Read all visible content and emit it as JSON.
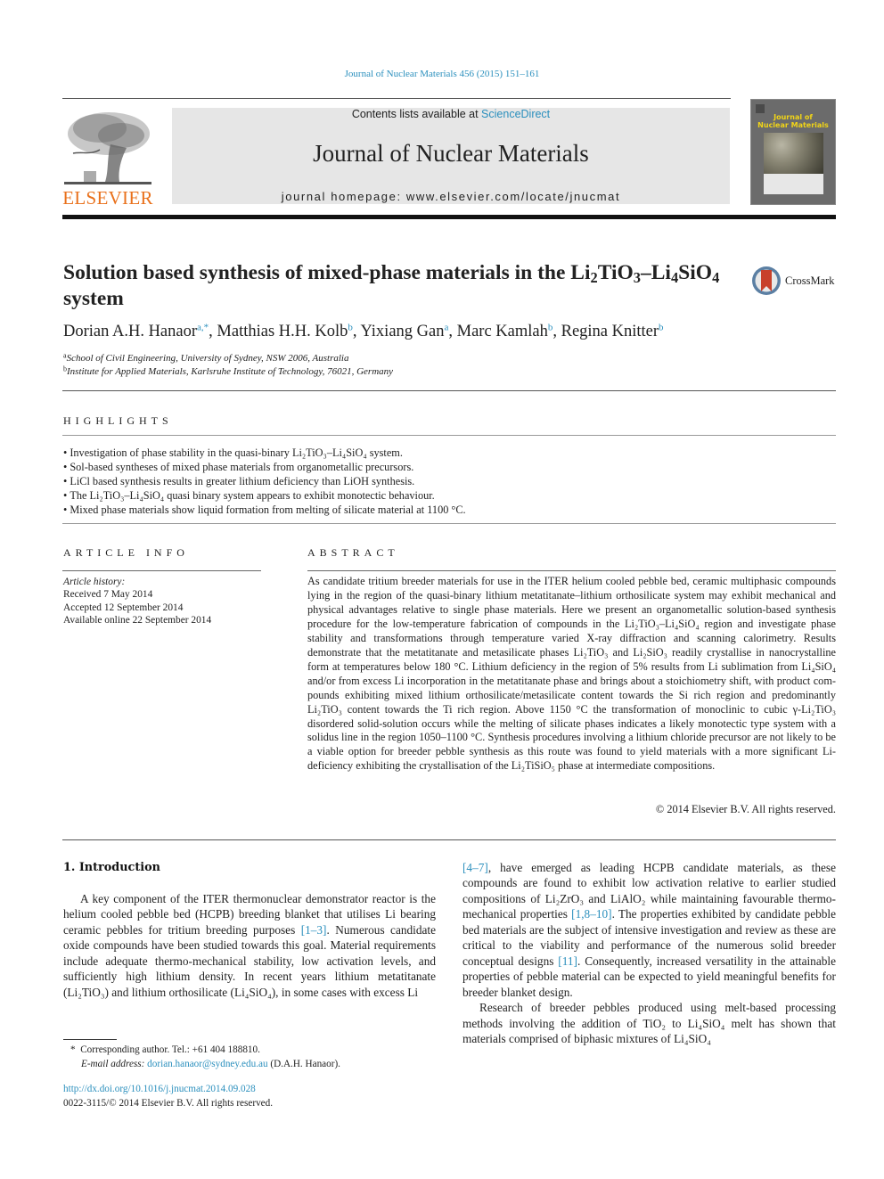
{
  "running_head": "Journal of Nuclear Materials 456 (2015) 151–161",
  "masthead": {
    "contents_prefix": "Contents lists available at ",
    "contents_link": "ScienceDirect",
    "journal_title": "Journal of Nuclear Materials",
    "homepage": "journal homepage: www.elsevier.com/locate/jnucmat"
  },
  "publisher_logo": {
    "wordmark": "ELSEVIER",
    "color": "#e9711c"
  },
  "cover": {
    "title_line1": "Journal of",
    "title_line2": "Nuclear Materials",
    "title_color": "#f1d417"
  },
  "crossmark": {
    "label": "CrossMark"
  },
  "article": {
    "title_pre": "Solution based synthesis of mixed-phase materials in the Li",
    "title_sub1": "2",
    "title_mid1": "TiO",
    "title_sub2": "3",
    "title_mid2": "–Li",
    "title_sub3": "4",
    "title_mid3": "SiO",
    "title_sub4": "4",
    "title_post": " system",
    "authors": [
      {
        "name": "Dorian A.H. Hanaor",
        "sup": "a,*"
      },
      {
        "name": "Matthias H.H. Kolb",
        "sup": "b"
      },
      {
        "name": "Yixiang Gan",
        "sup": "a"
      },
      {
        "name": "Marc Kamlah",
        "sup": "b"
      },
      {
        "name": "Regina Knitter",
        "sup": "b"
      }
    ],
    "affiliations": [
      {
        "key": "a",
        "text": "School of Civil Engineering, University of Sydney, NSW 2006, Australia"
      },
      {
        "key": "b",
        "text": "Institute for Applied Materials, Karlsruhe Institute of Technology, 76021, Germany"
      }
    ]
  },
  "highlights": {
    "heading": "HIGHLIGHTS",
    "items": [
      "Investigation of phase stability in the quasi-binary Li₂TiO₃–Li₄SiO₄ system.",
      "Sol-based syntheses of mixed phase materials from organometallic precursors.",
      "LiCl based synthesis results in greater lithium deficiency than LiOH synthesis.",
      "The Li₂TiO₃–Li₄SiO₄ quasi binary system appears to exhibit monotectic behaviour.",
      "Mixed phase materials show liquid formation from melting of silicate material at 1100 °C."
    ]
  },
  "article_info": {
    "heading": "ARTICLE INFO",
    "history_label": "Article history:",
    "received": "Received 7 May 2014",
    "accepted": "Accepted 12 September 2014",
    "online": "Available online 22 September 2014"
  },
  "abstract": {
    "heading": "ABSTRACT",
    "text": "As candidate tritium breeder materials for use in the ITER helium cooled pebble bed, ceramic multiphasic compounds lying in the region of the quasi-binary lithium metatitanate–lithium orthosilicate system may exhibit mechanical and physical advantages relative to single phase materials. Here we present an organometallic solution-based synthesis procedure for the low-temperature fabrication of compounds in the Li₂TiO₃–Li₄SiO₄ region and investigate phase stability and transformations through temperature varied X-ray diffraction and scanning calorimetry. Results demonstrate that the metatitanate and meta­silicate phases Li₂TiO₃ and Li₂SiO₃ readily crystallise in nanocrystalline form at temperatures below 180 °C. Lithium deficiency in the region of 5% results from Li sublimation from Li₄SiO₄ and/or from excess Li incorporation in the metatitanate phase and brings about a stoichiometry shift, with product com­pounds exhibiting mixed lithium orthosilicate/metasilicate content towards the Si rich region and pre­dominantly Li₂TiO₃ content towards the Ti rich region. Above 1150 °C the transformation of monoclinic to cubic γ-Li₂TiO₃ disordered solid-solution occurs while the melting of silicate phases indi­cates a likely monotectic type system with a solidus line in the region 1050–1100 °C. Synthesis proce­dures involving a lithium chloride precursor are not likely to be a viable option for breeder pebble synthesis as this route was found to yield materials with a more significant Li-deficiency exhibiting the crystallisation of the Li₂TiSiO₅ phase at intermediate compositions.",
    "copyright": "© 2014 Elsevier B.V. All rights reserved."
  },
  "introduction": {
    "heading": "1. Introduction",
    "left_p1_a": "A key component of the ITER thermonuclear demonstrator reactor is the helium cooled pebble bed (HCPB) breeding blanket that utilises Li bearing ceramic pebbles for tritium breeding purposes ",
    "left_ref1": "[1–3]",
    "left_p1_b": ". Numerous candidate oxide compounds have been studied towards this goal. Material requirements include adequate thermo-mechanical stability, low activation levels, and sufficiently high lithium density. In recent years lithium metatitanate (Li₂TiO₃) and lithium orthosilicate (Li₄SiO₄), in some cases with excess Li",
    "right_ref1": "[4–7]",
    "right_p1_a": ", have emerged as leading HCPB candidate materials, as these compounds are found to exhibit low activation relative to earlier studied compositions of Li₂ZrO₃ and LiAlO₂ while maintaining favourable thermo-mechanical properties ",
    "right_ref2": "[1,8–10]",
    "right_p1_b": ". The properties exhibited by candidate pebble bed materials are the subject of intensive investigation and review as these are critical to the via­bility and performance of the numerous solid breeder conceptual designs ",
    "right_ref3": "[11]",
    "right_p1_c": ". Consequently, increased versatility in the attainable properties of pebble material can be expected to yield meaningful benefits for breeder blanket design.",
    "right_p2": "Research of breeder pebbles produced using melt-based pro­cessing methods involving the addition of TiO₂ to Li₄SiO₄ melt has shown that materials comprised of biphasic mixtures of Li₄SiO₄"
  },
  "footnotes": {
    "corresponding": "Corresponding author. Tel.: +61 404 188810.",
    "email_label": "E-mail address:",
    "email": "dorian.hanaor@sydney.edu.au",
    "email_suffix": " (D.A.H. Hanaor).",
    "doi": "http://dx.doi.org/10.1016/j.jnucmat.2014.09.028",
    "issn": "0022-3115/© 2014 Elsevier B.V. All rights reserved."
  }
}
